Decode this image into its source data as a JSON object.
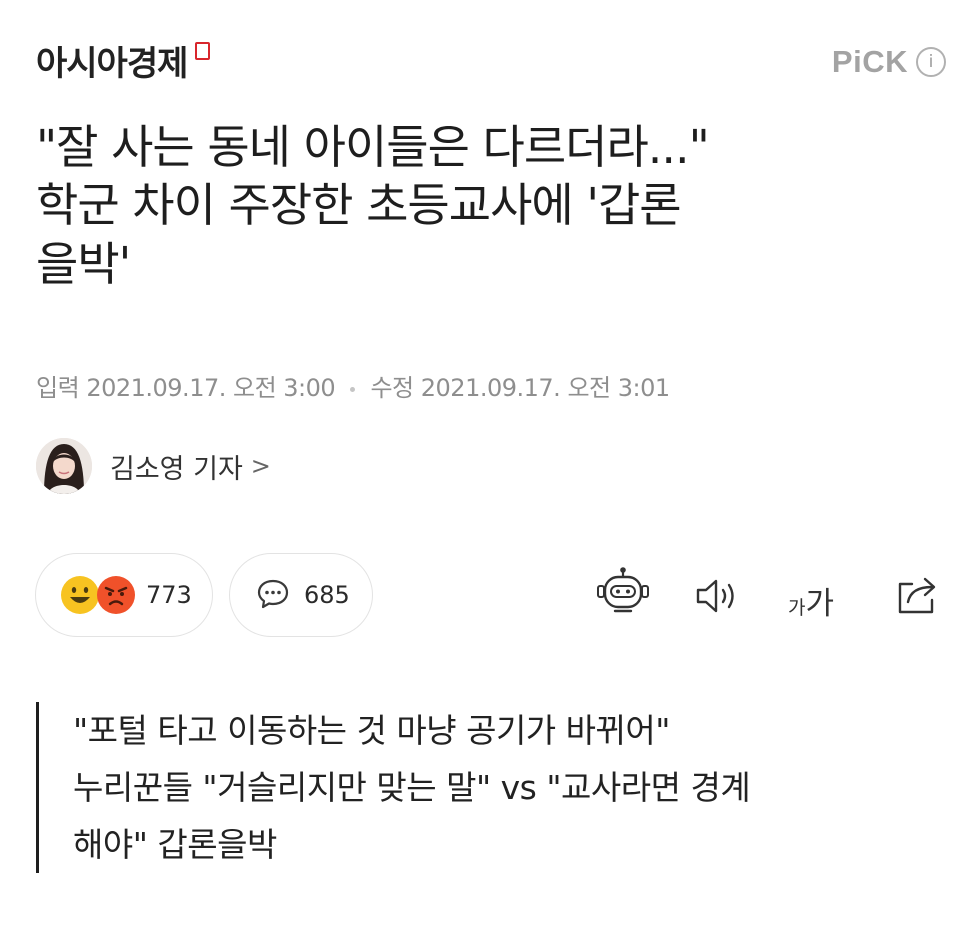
{
  "brand": {
    "name": "아시아경제",
    "pick_label": "PiCK",
    "info_glyph": "i"
  },
  "headline": {
    "lines": [
      "\"잘 사는 동네 아이들은 다르더라...\"",
      "학군 차이 주장한 초등교사에 '갑론",
      "을박'"
    ]
  },
  "meta": {
    "input_label": "입력",
    "input_time": "2021.09.17. 오전 3:00",
    "edit_label": "수정",
    "edit_time": "2021.09.17. 오전 3:01"
  },
  "reporter": {
    "name": "김소영 기자",
    "chevron": ">"
  },
  "reactions": {
    "count": "773"
  },
  "comments": {
    "count": "685"
  },
  "toolbar": {
    "font_size_label_small": "가",
    "font_size_label_large": "가"
  },
  "summary": {
    "lines": [
      "\"포털 타고 이동하는 것 마냥 공기가 바뀌어\"",
      "누리꾼들 \"거슬리지만 맞는 말\" vs \"교사라면 경계",
      "해야\" 갑론을박"
    ]
  },
  "colors": {
    "accent": "#d8262c",
    "emoji_yellow": "#f7c321",
    "emoji_red": "#f0512a",
    "text": "#1e1e1e",
    "muted": "#8e8e8e"
  },
  "icons": [
    "brand-mark-icon",
    "info-icon",
    "smile-emoji-icon",
    "angry-emoji-icon",
    "comment-icon",
    "robot-icon",
    "speaker-icon",
    "share-icon",
    "chevron-right-icon"
  ]
}
